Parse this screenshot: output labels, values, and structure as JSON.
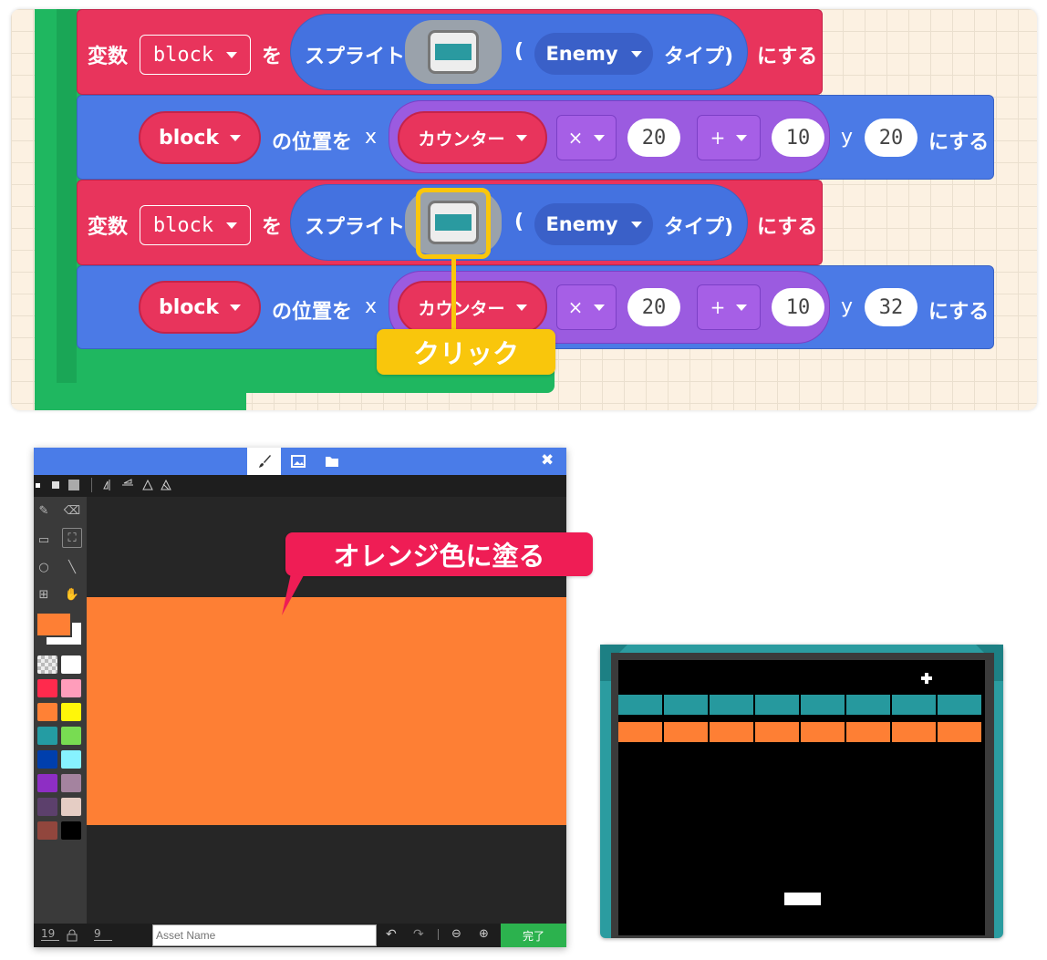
{
  "blocks": {
    "row1": {
      "set": "変数",
      "var": "block",
      "wo": "を",
      "sprite": "スプライト",
      "paren_open": "(",
      "kind": "Enemy",
      "type_label": "タイプ)",
      "suru": "にする"
    },
    "row2": {
      "var": "block",
      "pos": "の位置を",
      "x": "x",
      "counter": "カウンター",
      "mul": "×",
      "n1": "20",
      "plus": "+",
      "n2": "10",
      "y": "y",
      "yval": "20",
      "suru": "にする"
    },
    "row3": {
      "set": "変数",
      "var": "block",
      "wo": "を",
      "sprite": "スプライト",
      "paren_open": "(",
      "kind": "Enemy",
      "type_label": "タイプ)",
      "suru": "にする"
    },
    "row4": {
      "var": "block",
      "pos": "の位置を",
      "x": "x",
      "counter": "カウンター",
      "mul": "×",
      "n1": "20",
      "plus": "+",
      "n2": "10",
      "y": "y",
      "yval": "32",
      "suru": "にする"
    }
  },
  "callouts": {
    "click": "クリック",
    "paint_orange": "オレンジ色に塗る"
  },
  "editor": {
    "close": "✖",
    "width": "19",
    "height": "9",
    "asset_placeholder": "Asset Name",
    "done": "完了",
    "palette": [
      "#transparent",
      "#ffffff",
      "#ff2a4d",
      "#ff9dbb",
      "#ff8135",
      "#fff609",
      "#249ca3",
      "#78dc52",
      "#003fad",
      "#87f2ff",
      "#8e2ec4",
      "#a4839f",
      "#5c406c",
      "#e5cdc4",
      "#91463d",
      "#000000"
    ],
    "fg_color": "#fe7f34",
    "bg_color": "#ffffff"
  },
  "game": {
    "teal": "#26999e",
    "orange": "#fe7f34",
    "bricks_per_row": 8
  }
}
